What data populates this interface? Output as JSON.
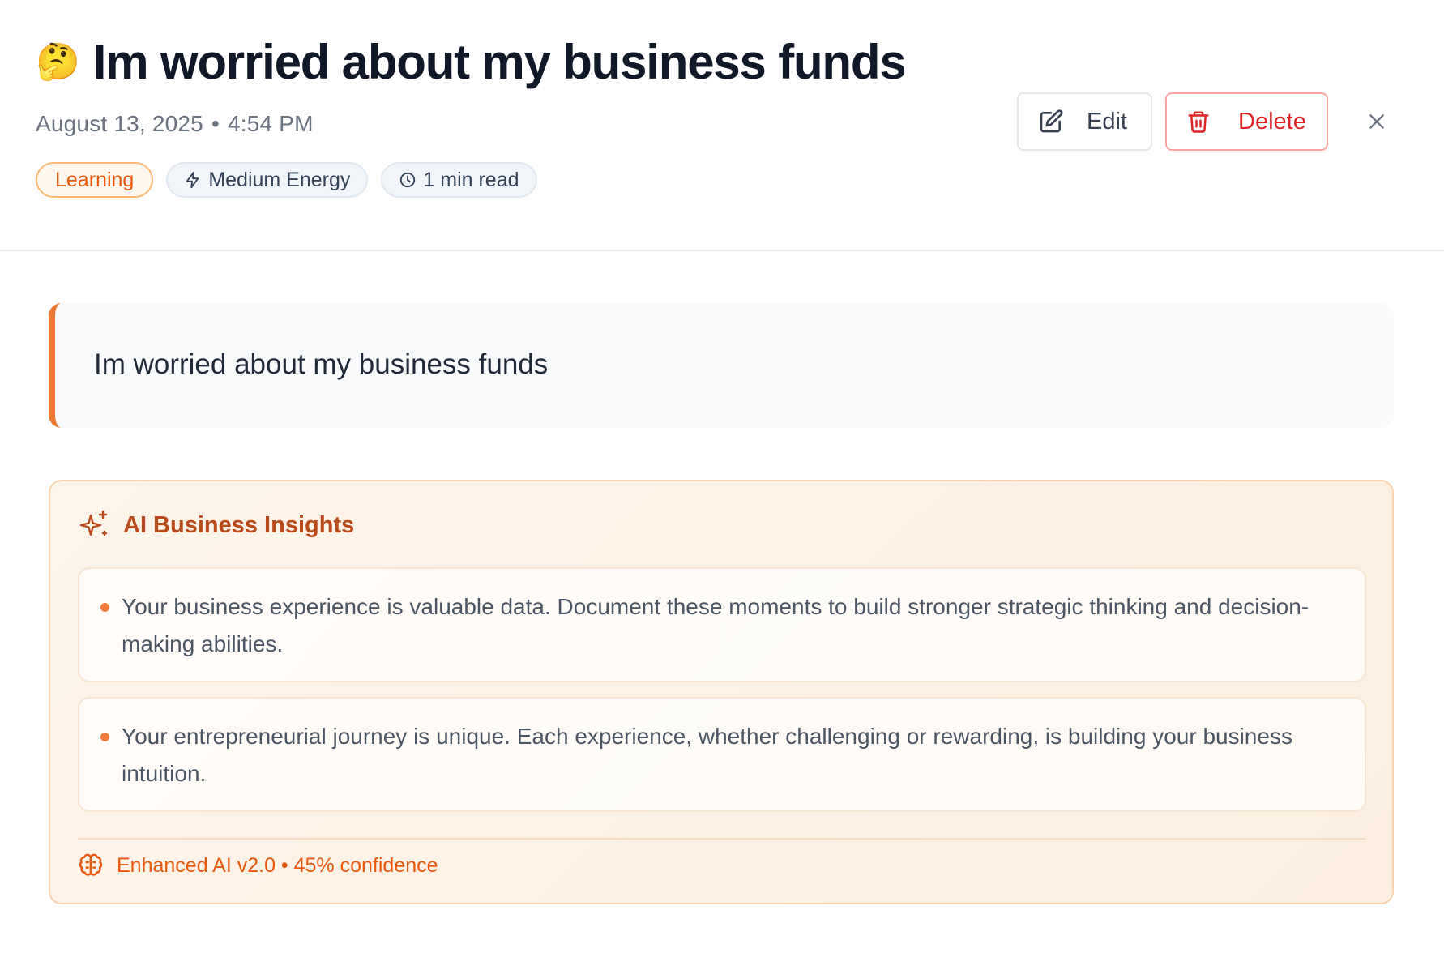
{
  "entry": {
    "emoji": "🤔",
    "title": "Im worried about my business funds",
    "date": "August 13, 2025",
    "separator": "•",
    "time": "4:54 PM",
    "content": "Im worried about my business funds"
  },
  "tags": {
    "category": "Learning",
    "energy": "Medium Energy",
    "read_time": "1 min read"
  },
  "actions": {
    "edit_label": "Edit",
    "delete_label": "Delete",
    "close_icon": "close-icon"
  },
  "ai_insights": {
    "title": "AI Business Insights",
    "items": [
      "Your business experience is valuable data. Document these moments to build stronger strategic thinking and decision-making abilities.",
      "Your entrepreneurial journey is unique. Each experience, whether challenging or rewarding, is building your business intuition."
    ],
    "footer": "Enhanced AI v2.0 • 45% confidence"
  },
  "colors": {
    "accent": "#ea580c",
    "delete": "#dc2626",
    "title": "#111827"
  }
}
